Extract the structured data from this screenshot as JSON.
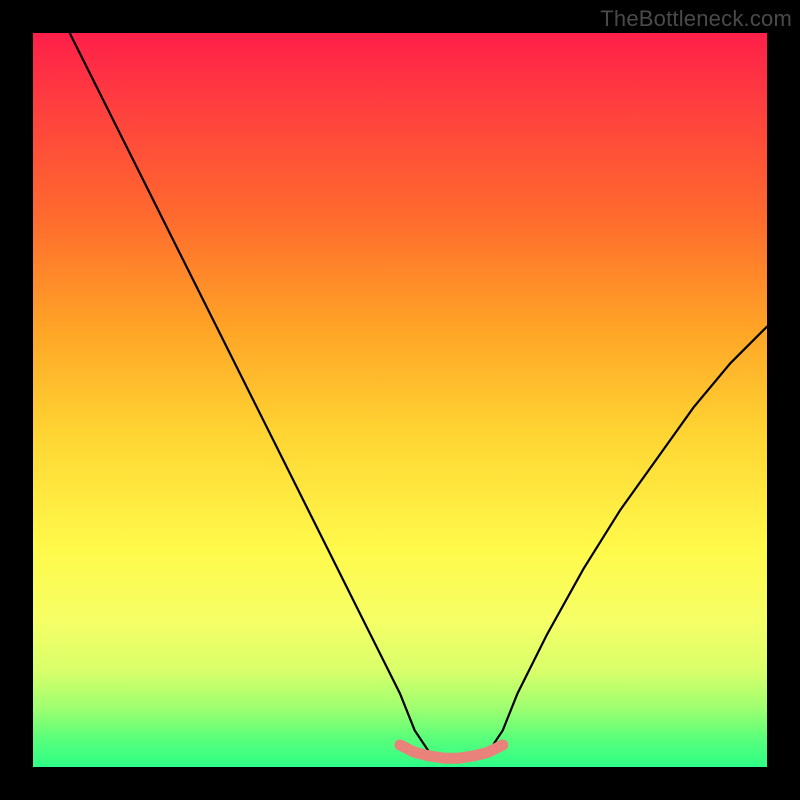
{
  "watermark": "TheBottleneck.com",
  "chart_data": {
    "type": "line",
    "title": "",
    "xlabel": "",
    "ylabel": "",
    "xlim": [
      0,
      100
    ],
    "ylim": [
      0,
      100
    ],
    "series": [
      {
        "name": "bottleneck-curve",
        "x": [
          5,
          10,
          15,
          20,
          25,
          30,
          35,
          40,
          45,
          50,
          52,
          54,
          56,
          58,
          60,
          62,
          64,
          66,
          70,
          75,
          80,
          85,
          90,
          95,
          100
        ],
        "values": [
          100,
          90,
          80,
          70,
          60,
          50,
          40,
          30,
          20,
          10,
          5,
          2,
          1,
          1,
          1,
          2,
          5,
          10,
          18,
          27,
          35,
          42,
          49,
          55,
          60
        ]
      },
      {
        "name": "highlight-segment",
        "x": [
          50,
          52,
          54,
          56,
          58,
          60,
          62,
          64
        ],
        "values": [
          3,
          2,
          1.5,
          1.2,
          1.2,
          1.5,
          2,
          3
        ]
      }
    ],
    "colors": {
      "curve": "#000000",
      "highlight": "#e8827a"
    }
  }
}
